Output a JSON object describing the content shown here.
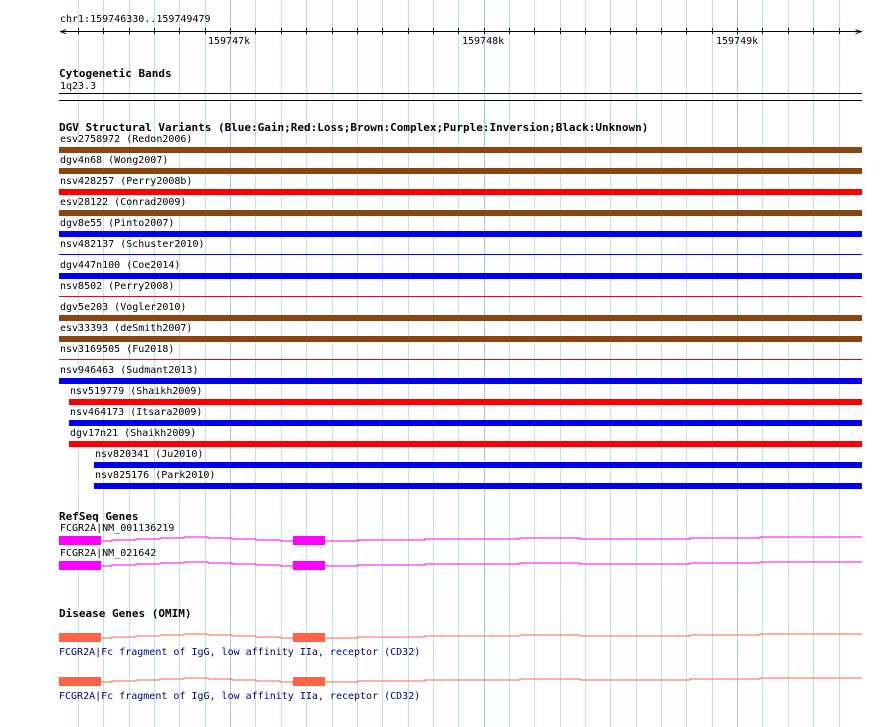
{
  "ruler": {
    "location": "chr1:159746330..159749479",
    "labels": [
      "159747k",
      "159748k",
      "159749k"
    ]
  },
  "cytoband": {
    "title": "Cytogenetic Bands",
    "band": "1q23.3"
  },
  "dgv": {
    "title": "DGV Structural Variants (Blue:Gain;Red:Loss;Brown:Complex;Purple:Inversion;Black:Unknown)",
    "colors": {
      "gain": "#0000ee",
      "loss": "#ff0000",
      "complex": "#8b4513"
    },
    "variants": [
      {
        "label": "esv2758972 (Redon2006)",
        "type": "complex",
        "thin": false,
        "indent": 0
      },
      {
        "label": "dgv4n68 (Wong2007)",
        "type": "complex",
        "thin": false,
        "indent": 0
      },
      {
        "label": "nsv428257 (Perry2008b)",
        "type": "loss",
        "thin": false,
        "indent": 0
      },
      {
        "label": "esv28122 (Conrad2009)",
        "type": "complex",
        "thin": false,
        "indent": 0
      },
      {
        "label": "dgv8e55 (Pinto2007)",
        "type": "gain",
        "thin": false,
        "indent": 0
      },
      {
        "label": "nsv482137 (Schuster2010)",
        "type": "gain",
        "thin": true,
        "indent": 0
      },
      {
        "label": "dgv447n100 (Coe2014)",
        "type": "gain",
        "thin": false,
        "indent": 0
      },
      {
        "label": "nsv8502 (Perry2008)",
        "type": "loss",
        "thin": true,
        "indent": 0
      },
      {
        "label": "dgv5e203 (Vogler2010)",
        "type": "complex",
        "thin": false,
        "indent": 0
      },
      {
        "label": "esv33393 (deSmith2007)",
        "type": "complex",
        "thin": false,
        "indent": 0
      },
      {
        "label": "nsv3169505 (Fu2018)",
        "type": "loss",
        "thin": true,
        "indent": 0
      },
      {
        "label": "nsv946463 (Sudmant2013)",
        "type": "gain",
        "thin": false,
        "indent": 0
      },
      {
        "label": "nsv519779 (Shaikh2009)",
        "type": "loss",
        "thin": false,
        "indent": 1
      },
      {
        "label": "nsv464173 (Itsara2009)",
        "type": "gain",
        "thin": false,
        "indent": 1
      },
      {
        "label": "dgv17n21 (Shaikh2009)",
        "type": "loss",
        "thin": false,
        "indent": 1
      },
      {
        "label": "nsv820341 (Ju2010)",
        "type": "gain",
        "thin": false,
        "indent": 2
      },
      {
        "label": "nsv825176 (Park2010)",
        "type": "gain",
        "thin": false,
        "indent": 2
      }
    ]
  },
  "refseq": {
    "title": "RefSeq Genes",
    "color": "#ff00ff",
    "genes": [
      {
        "label": "FCGR2A|NM_001136219"
      },
      {
        "label": "FCGR2A|NM_021642"
      }
    ]
  },
  "omim": {
    "title": "Disease Genes (OMIM)",
    "color": "#ff6347",
    "genes": [
      {
        "label": "FCGR2A|Fc fragment of IgG, low affinity IIa, receptor (CD32)"
      },
      {
        "label": "FCGR2A|Fc fragment of IgG, low affinity IIa, receptor (CD32)"
      }
    ]
  }
}
